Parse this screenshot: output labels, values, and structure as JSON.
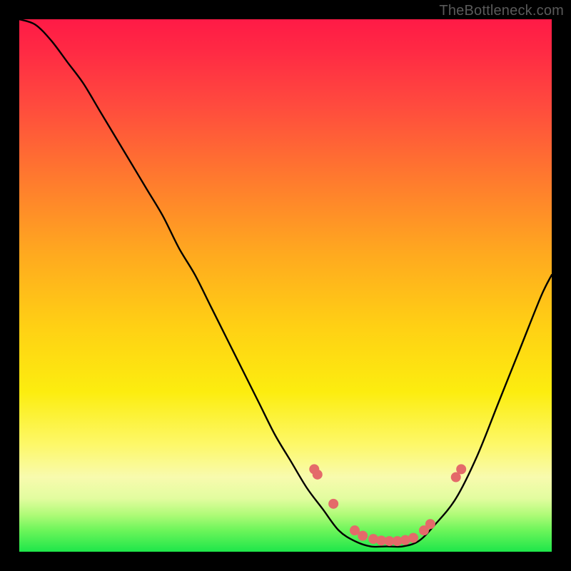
{
  "watermark": "TheBottleneck.com",
  "colors": {
    "dot": "#e46a6a",
    "curve_stroke": "#000000",
    "gradient_top": "#ff1a46",
    "gradient_bottom": "#1ee64a",
    "frame": "#000000"
  },
  "chart_data": {
    "type": "line",
    "title": "",
    "xlabel": "",
    "ylabel": "",
    "xlim": [
      0,
      100
    ],
    "ylim": [
      0,
      100
    ],
    "grid": false,
    "legend": false,
    "series": [
      {
        "name": "bottleneck-curve",
        "x": [
          0,
          3,
          6,
          9,
          12,
          15,
          18,
          21,
          24,
          27,
          30,
          33,
          36,
          39,
          42,
          45,
          48,
          51,
          54,
          57,
          60,
          63,
          66,
          69,
          72,
          75,
          78,
          82,
          86,
          90,
          94,
          98,
          100
        ],
        "y": [
          100,
          99,
          96,
          92,
          88,
          83,
          78,
          73,
          68,
          63,
          57,
          52,
          46,
          40,
          34,
          28,
          22,
          17,
          12,
          8,
          4,
          2,
          1,
          1,
          1,
          2,
          5,
          10,
          18,
          28,
          38,
          48,
          52
        ]
      }
    ],
    "markers": [
      {
        "x": 55.4,
        "y": 15.5
      },
      {
        "x": 56.0,
        "y": 14.5
      },
      {
        "x": 59.0,
        "y": 9.0
      },
      {
        "x": 63.0,
        "y": 4.0
      },
      {
        "x": 64.5,
        "y": 3.0
      },
      {
        "x": 66.5,
        "y": 2.4
      },
      {
        "x": 68.0,
        "y": 2.1
      },
      {
        "x": 69.5,
        "y": 2.0
      },
      {
        "x": 71.0,
        "y": 2.0
      },
      {
        "x": 72.5,
        "y": 2.2
      },
      {
        "x": 74.0,
        "y": 2.6
      },
      {
        "x": 76.0,
        "y": 4.0
      },
      {
        "x": 77.2,
        "y": 5.2
      },
      {
        "x": 82.0,
        "y": 14.0
      },
      {
        "x": 83.0,
        "y": 15.5
      }
    ],
    "marker_radius": 7
  }
}
